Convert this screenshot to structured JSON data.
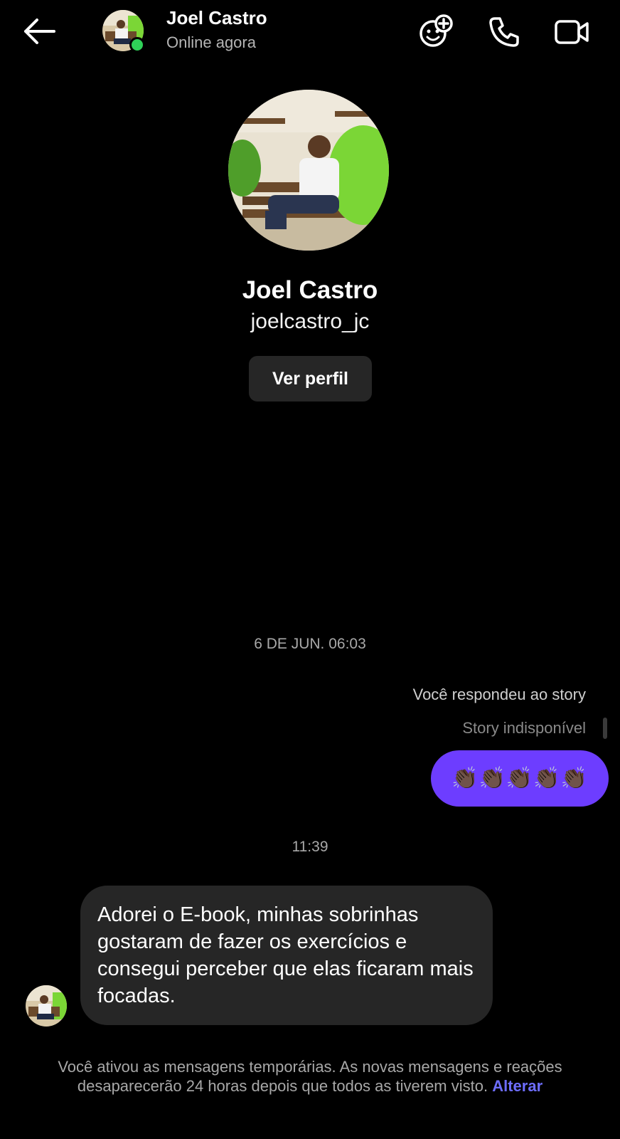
{
  "header": {
    "name": "Joel Castro",
    "status": "Online agora"
  },
  "profile": {
    "name": "Joel Castro",
    "username": "joelcastro_jc",
    "view_profile_label": "Ver perfil"
  },
  "messages": {
    "timestamp_1": "6 DE JUN. 06:03",
    "reply_label": "Você respondeu ao story",
    "story_unavailable": "Story indisponível",
    "sent_text": "👏🏿👏🏿👏🏿👏🏿👏🏿",
    "timestamp_2": "11:39",
    "received_text": "Adorei o E-book, minhas sobrinhas gostaram de fazer os exercícios e consegui perceber que elas ficaram mais focadas."
  },
  "footer": {
    "text": "Você ativou as mensagens temporárias. As novas mensagens e reações desaparecerão 24 horas depois que todos as tiverem visto.",
    "link": "Alterar"
  },
  "colors": {
    "sent_bubble": "#6d3dff",
    "received_bubble": "#262626",
    "online": "#2fd158",
    "link": "#6d6dff"
  },
  "icons": [
    "back-arrow-icon",
    "add-effect-icon",
    "phone-icon",
    "video-icon"
  ]
}
